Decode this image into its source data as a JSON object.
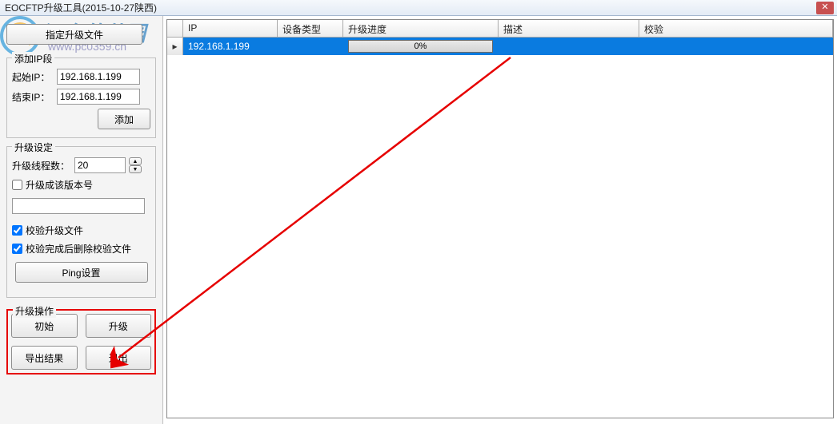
{
  "window": {
    "title": "EOCFTP升级工具(2015-10-27陕西)"
  },
  "watermark": {
    "text": "河东软件园",
    "url": "www.pc0359.cn"
  },
  "left": {
    "specify_file_btn": "指定升级文件",
    "add_ip_group": "添加IP段",
    "start_ip_label": "起始IP：",
    "start_ip_value": "192.168.1.199",
    "end_ip_label": "结束IP：",
    "end_ip_value": "192.168.1.199",
    "add_btn": "添加",
    "upgrade_setting_group": "升级设定",
    "thread_label": "升级线程数：",
    "thread_value": "20",
    "chk_version": "升级成该版本号",
    "chk_verify": "校验升级文件",
    "chk_del_after_verify": "校验完成后删除校验文件",
    "ping_btn": "Ping设置",
    "op_group": "升级操作",
    "op_init": "初始",
    "op_upgrade": "升级",
    "op_export": "导出结果",
    "op_exit": "退出"
  },
  "table": {
    "headers": {
      "ip": "IP",
      "type": "设备类型",
      "progress": "升级进度",
      "desc": "描述",
      "check": "校验"
    },
    "rows": [
      {
        "ip": "192.168.1.199",
        "type": "",
        "progress_text": "0%",
        "desc": "",
        "check": ""
      }
    ]
  }
}
